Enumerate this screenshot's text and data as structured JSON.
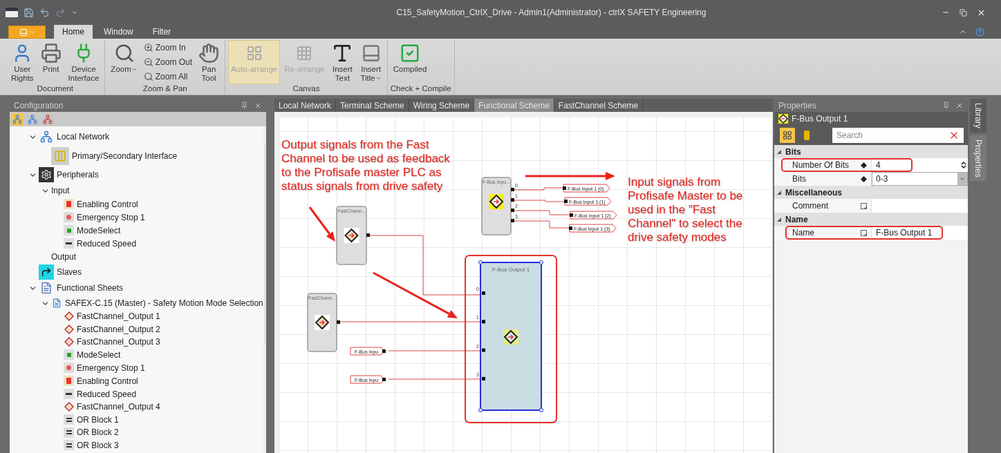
{
  "window": {
    "title": "C15_SafetyMotion_CtrlX_Drive - Admin1(Administrator) - ctrlX SAFETY Engineering"
  },
  "ribbon_tabs": [
    {
      "label": "Home",
      "selected": true
    },
    {
      "label": "Window",
      "selected": false
    },
    {
      "label": "Filter",
      "selected": false
    }
  ],
  "ribbon_groups": [
    {
      "label": "Document",
      "items": [
        {
          "label": "User\nRights",
          "kind": "large",
          "disabled": false,
          "hovered": false,
          "has_menu": false
        },
        {
          "label": "Print",
          "kind": "large",
          "disabled": false,
          "hovered": false,
          "has_menu": false
        },
        {
          "label": "Device\nInterface",
          "kind": "large",
          "disabled": false,
          "hovered": false,
          "has_menu": false
        }
      ]
    },
    {
      "label": "Zoom & Pan",
      "items": [
        {
          "label": "Zoom",
          "kind": "large",
          "disabled": false,
          "hovered": false,
          "has_menu": true
        },
        {
          "label": "Zoom In",
          "kind": "small",
          "disabled": false
        },
        {
          "label": "Zoom Out",
          "kind": "small",
          "disabled": false
        },
        {
          "label": "Zoom All",
          "kind": "small",
          "disabled": false
        },
        {
          "label": "Pan\nTool",
          "kind": "large",
          "disabled": false,
          "hovered": false,
          "has_menu": false
        }
      ]
    },
    {
      "label": "Canvas",
      "items": [
        {
          "label": "Auto-arrange",
          "kind": "large",
          "disabled": true,
          "hovered": true,
          "has_menu": false
        },
        {
          "label": "Re-arrange",
          "kind": "large",
          "disabled": true,
          "hovered": false,
          "has_menu": false
        },
        {
          "label": "Insert\nText",
          "kind": "large",
          "disabled": false,
          "hovered": false,
          "has_menu": false
        },
        {
          "label": "Insert\nTitle",
          "kind": "large",
          "disabled": false,
          "hovered": false,
          "has_menu": true
        }
      ]
    },
    {
      "label": "Check + Compile",
      "items": [
        {
          "label": "Compiled",
          "kind": "large",
          "disabled": false,
          "hovered": false,
          "has_menu": false
        }
      ]
    }
  ],
  "configuration": {
    "title": "Configuration",
    "toolbar": [
      {
        "selected": true
      },
      {
        "selected": false
      },
      {
        "selected": false
      }
    ],
    "tree": [
      {
        "label": "Local Network",
        "kind": "network",
        "expanded": true,
        "children": [
          {
            "label": "Primary/Secondary Interface",
            "kind": "interface"
          }
        ]
      },
      {
        "label": "Peripherals",
        "kind": "gear",
        "expanded": true,
        "children": [
          {
            "label": "Input",
            "kind": "group",
            "expanded": true,
            "children": [
              {
                "label": "Enabling Control",
                "kind": "enabling"
              },
              {
                "label": "Emergency Stop 1",
                "kind": "estop"
              },
              {
                "label": "ModeSelect",
                "kind": "mode"
              },
              {
                "label": "Reduced Speed",
                "kind": "speed"
              }
            ]
          },
          {
            "label": "Output",
            "kind": "group"
          }
        ]
      },
      {
        "label": "Slaves",
        "kind": "slaves"
      },
      {
        "label": "Functional Sheets",
        "kind": "sheets",
        "expanded": true,
        "children": [
          {
            "label": "SAFEX-C.15 (Master) - Safety Motion Mode Selection",
            "kind": "sheet",
            "expanded": true,
            "children": [
              {
                "label": "FastChannel_Output 1",
                "kind": "fastchannel"
              },
              {
                "label": "FastChannel_Output 2",
                "kind": "fastchannel"
              },
              {
                "label": "FastChannel_Output 3",
                "kind": "fastchannel"
              },
              {
                "label": "ModeSelect",
                "kind": "mode"
              },
              {
                "label": "Emergency Stop 1",
                "kind": "estop"
              },
              {
                "label": "Enabling Control",
                "kind": "enabling"
              },
              {
                "label": "Reduced Speed",
                "kind": "speed"
              },
              {
                "label": "FastChannel_Output 4",
                "kind": "fastchannel"
              },
              {
                "label": "OR Block 1",
                "kind": "or"
              },
              {
                "label": "OR Block 2",
                "kind": "or"
              },
              {
                "label": "OR Block 3",
                "kind": "or"
              }
            ]
          }
        ]
      }
    ]
  },
  "editor_tabs": [
    {
      "label": "Local Network",
      "selected": false
    },
    {
      "label": "Terminal Scheme",
      "selected": false
    },
    {
      "label": "Wiring Scheme",
      "selected": false
    },
    {
      "label": "Functional Scheme",
      "selected": true
    },
    {
      "label": "FastChannel Scheme",
      "selected": false
    }
  ],
  "diagram": {
    "notes": [
      "Output signals from the Fast\nChannel to be used as feedback\nto the Profisafe master PLC as\nstatus signals from drive safety",
      "Input signals from\nProfisafe Master to be\nused in the \"Fast\nChannel\" to select the\ndrive safety modes"
    ],
    "blocks": [
      {
        "title": "FastChann...",
        "kind": "fastchannel",
        "selected": false,
        "highlighted": false
      },
      {
        "title": "F-Bus Inpu...",
        "kind": "fbus_input",
        "selected": false,
        "highlighted": false,
        "ports": [
          "0",
          "1",
          "2",
          "3"
        ]
      },
      {
        "title": "FastChann...",
        "kind": "fastchannel",
        "selected": false,
        "highlighted": false
      },
      {
        "title": "F-Bus Output 1",
        "kind": "fbus_output",
        "selected": true,
        "highlighted": true,
        "ports": [
          "0",
          "1",
          "2",
          "3"
        ]
      }
    ],
    "tags": [
      "F-Bus Input 1 (0)",
      "F-Bus Input 1 (1)",
      "F-Bus Input 1 (2)",
      "F-Bus Input 1 (3)",
      "F-Bus Inpu",
      "F-Bus Inpu"
    ]
  },
  "properties": {
    "title": "Properties",
    "object": "F-Bus Output 1",
    "search": {
      "placeholder": "Search"
    },
    "categories": [
      {
        "label": "Bits",
        "expanded": true,
        "rows": [
          {
            "label": "Number Of Bits",
            "value": "4",
            "kind": "spin",
            "highlighted": true
          },
          {
            "label": "Bits",
            "value": "0-3",
            "kind": "dropdown",
            "highlighted": false
          }
        ]
      },
      {
        "label": "Miscellaneous",
        "expanded": true,
        "rows": [
          {
            "label": "Comment",
            "kind": "text",
            "highlighted": false
          }
        ]
      },
      {
        "label": "Name",
        "expanded": true,
        "rows": [
          {
            "label": "Name",
            "value": "F-Bus Output 1",
            "kind": "text",
            "highlighted": true
          }
        ]
      }
    ]
  },
  "side_tabs": [
    {
      "label": "Library",
      "selected": false
    },
    {
      "label": "Properties",
      "selected": true
    }
  ]
}
